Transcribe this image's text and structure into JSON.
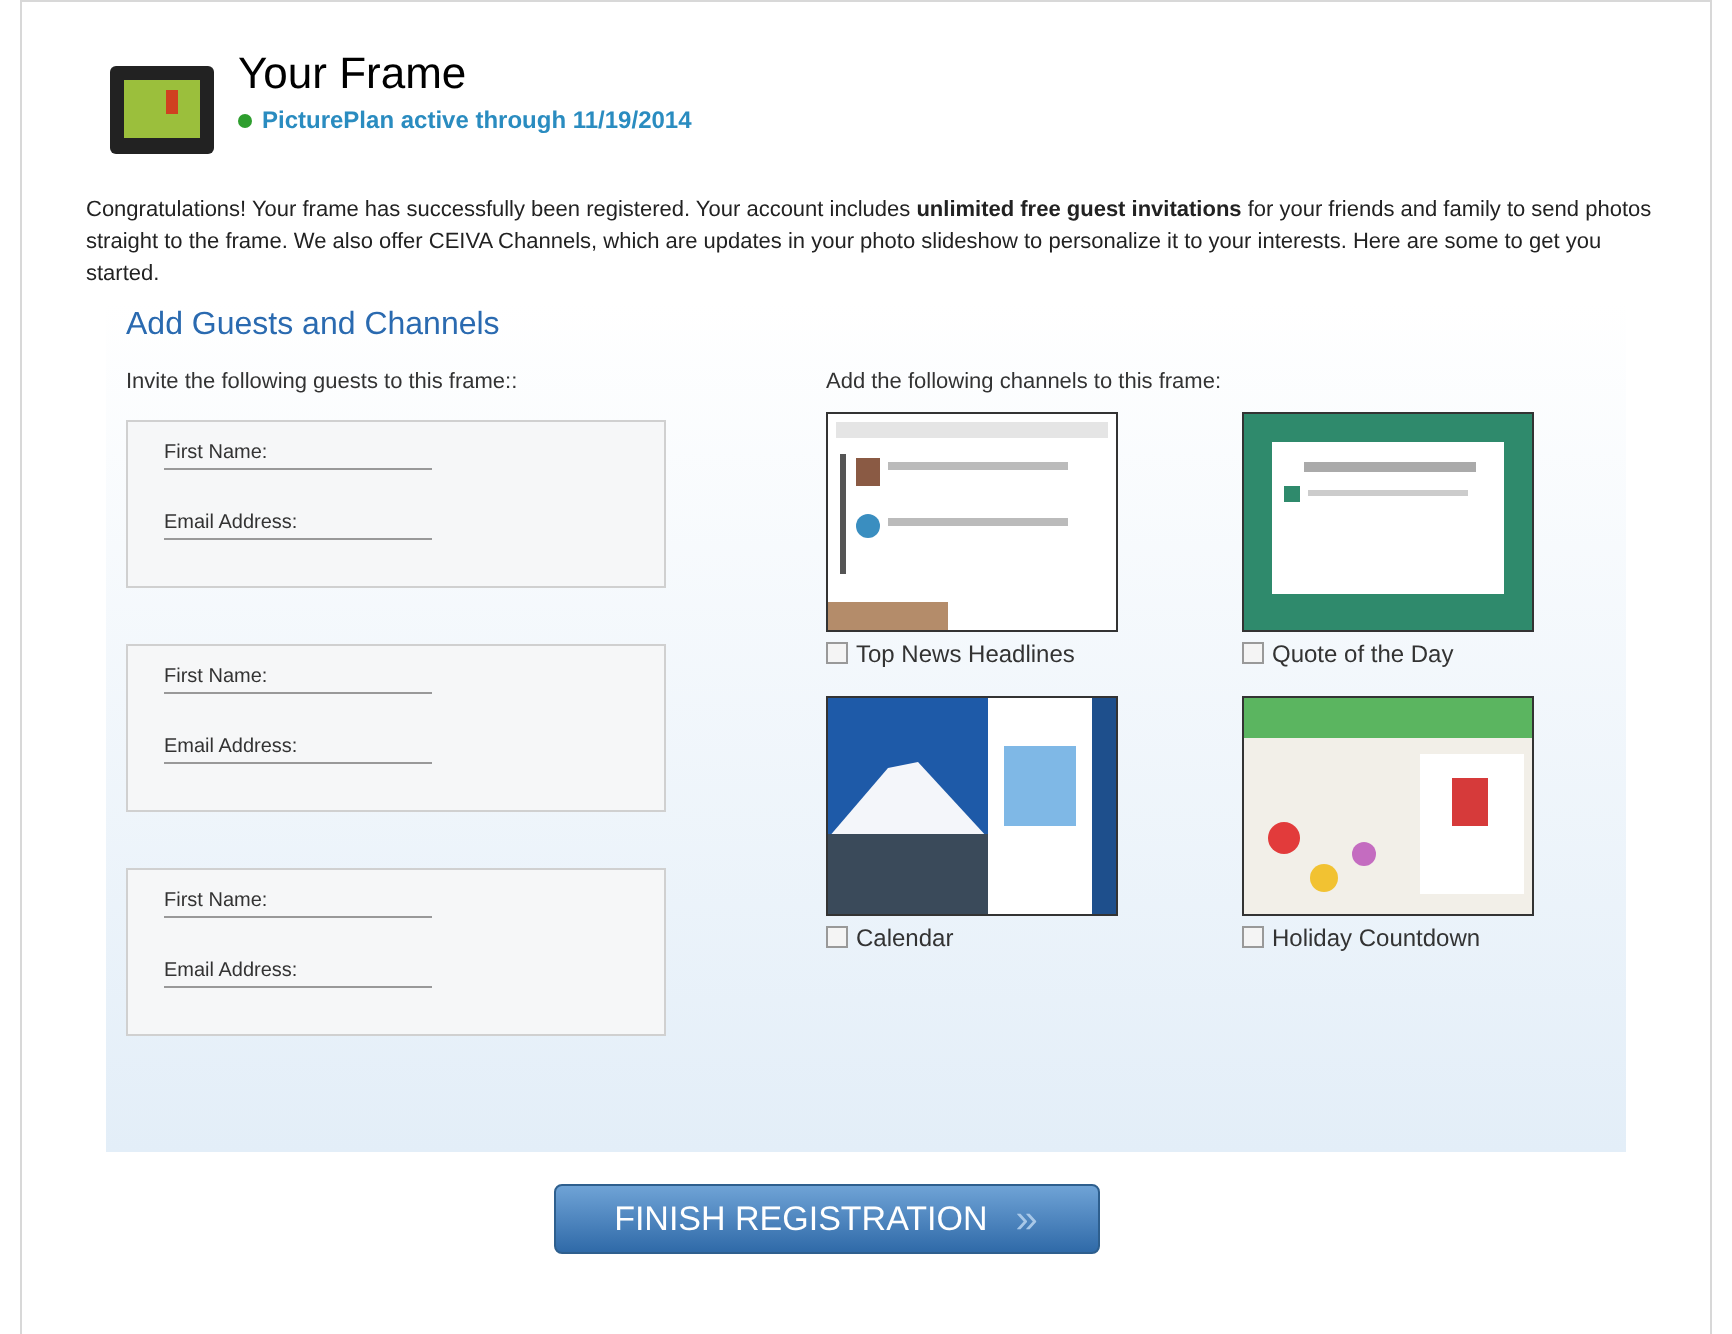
{
  "header": {
    "title": "Your Frame",
    "plan_status": {
      "text": "PicturePlan active through 11/19/2014",
      "active": true
    }
  },
  "intro": "Congratulations! Your frame has successfully been registered. Your account includes **unlimited free guest invitations** for your friends and family to send photos straight to the frame. We also offer CEIVA Channels, which are updates in your photo slideshow to personalize it to your interests. Here are some to get you started.",
  "section_title": "Add Guests and Channels",
  "guests": {
    "heading": "Invite the following guests to this frame::",
    "entries": [
      {
        "first_name_label": "First Name:",
        "email_label": "Email Address:"
      },
      {
        "first_name_label": "First Name:",
        "email_label": "Email Address:"
      },
      {
        "first_name_label": "First Name:",
        "email_label": "Email Address:"
      }
    ]
  },
  "channels": {
    "heading": "Add the following channels to this frame:",
    "items": [
      {
        "label": "Top News Headlines",
        "checked": false,
        "kind": "picture"
      },
      {
        "label": "Quote of the Day",
        "checked": false,
        "kind": "picture"
      },
      {
        "label": "Calendar",
        "checked": false,
        "kind": "picture"
      },
      {
        "label": "Holiday Countdown",
        "checked": false,
        "kind": "picture"
      }
    ]
  },
  "finish_button": {
    "label": "FINISH REGISTRATION",
    "icon": "»"
  }
}
